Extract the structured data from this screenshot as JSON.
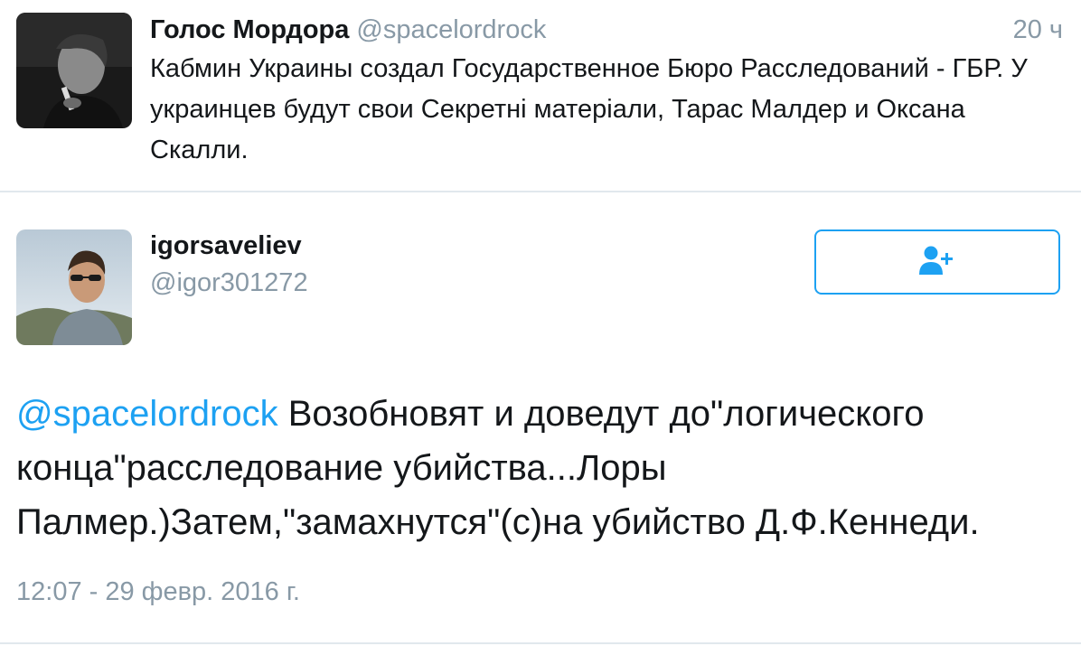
{
  "parent_tweet": {
    "author_name": "Голос Мордора",
    "author_handle": "@spacelordrock",
    "time": "20 ч",
    "text": "Кабмин Украины создал Государственное Бюро Расследований - ГБР. У украинцев будут свои Секретні матеріали, Тарас Малдер и Оксана Скалли."
  },
  "tweet": {
    "user_name": "igorsaveliev",
    "user_handle": "@igor301272",
    "follow_icon": "follow-user-icon",
    "mention": "@spacelordrock",
    "text": " Возобновят и доведут до\"логического конца\"расследование убийства...Лоры Палмер.)Затем,\"замахнутся\"(с)на убийство Д.Ф.Кеннеди.",
    "timestamp": "12:07 - 29 февр. 2016 г."
  },
  "colors": {
    "accent": "#1da1f2",
    "muted": "#8899a6",
    "text": "#14171a",
    "divider": "#e1e8ed"
  }
}
